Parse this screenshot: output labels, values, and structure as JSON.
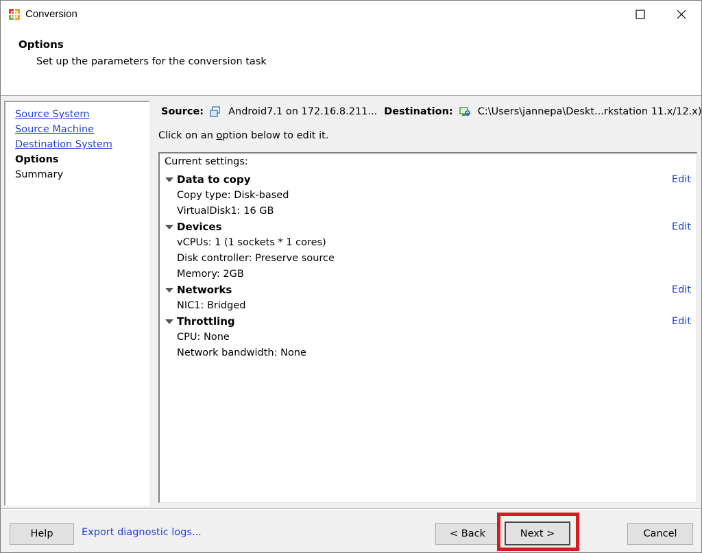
{
  "window": {
    "title": "Conversion"
  },
  "header": {
    "title": "Options",
    "subtitle": "Set up the parameters for the conversion task"
  },
  "nav": {
    "items": [
      {
        "label": "Source System",
        "state": "link"
      },
      {
        "label": "Source Machine",
        "state": "link"
      },
      {
        "label": "Destination System",
        "state": "link"
      },
      {
        "label": "Options",
        "state": "current"
      },
      {
        "label": "Summary",
        "state": "pending"
      }
    ]
  },
  "summary_bar": {
    "source_label": "Source:",
    "source_value": "Android7.1 on 172.16.8.211...",
    "destination_label": "Destination:",
    "destination_value": "C:\\Users\\jannepa\\Deskt...rkstation 11.x/12.x)"
  },
  "hint": {
    "before": "Click on an ",
    "underlined": "o",
    "after": "ption below to edit it."
  },
  "settings": {
    "heading": "Current settings:",
    "sections": [
      {
        "name": "Data to copy",
        "edit_label": "Edit",
        "details": [
          "Copy type: Disk-based",
          "VirtualDisk1: 16 GB"
        ]
      },
      {
        "name": "Devices",
        "edit_label": "Edit",
        "details": [
          "vCPUs: 1 (1 sockets * 1 cores)",
          "Disk controller: Preserve source",
          "Memory: 2GB"
        ]
      },
      {
        "name": "Networks",
        "edit_label": "Edit",
        "details": [
          "NIC1: Bridged"
        ]
      },
      {
        "name": "Throttling",
        "edit_label": "Edit",
        "details": [
          "CPU: None",
          "Network bandwidth: None"
        ]
      }
    ]
  },
  "footer": {
    "help_label": "Help",
    "export_logs_label": "Export diagnostic logs...",
    "back_label": "< Back",
    "next_label": "Next >",
    "cancel_label": "Cancel"
  },
  "colors": {
    "link": "#1f3fd6",
    "highlight": "#d71920"
  }
}
